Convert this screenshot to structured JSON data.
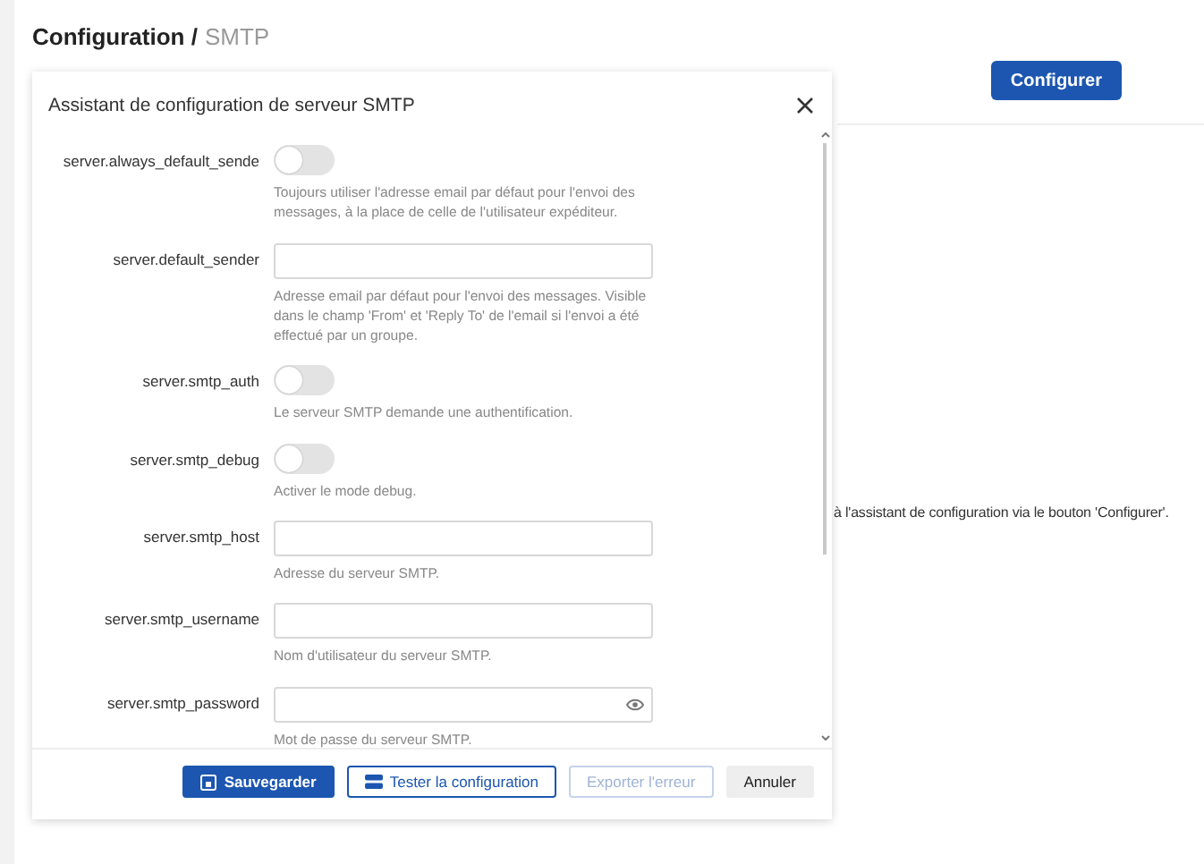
{
  "breadcrumb": {
    "section": "Configuration /",
    "page": "SMTP"
  },
  "configure_button": "Configurer",
  "background_text": "à l'assistant de configuration via le bouton 'Configurer'.",
  "dialog": {
    "title": "Assistant de configuration de serveur SMTP",
    "fields": [
      {
        "kind": "toggle",
        "label": "server.always_default_sende",
        "on": false,
        "help": "Toujours utiliser l'adresse email par défaut pour l'envoi des messages, à la place de celle de l'utilisateur expéditeur."
      },
      {
        "kind": "text",
        "label": "server.default_sender",
        "help": "Adresse email par défaut pour l'envoi des messages. Visible dans le champ 'From' et 'Reply To' de l'email si l'envoi a été effectué par un groupe."
      },
      {
        "kind": "toggle",
        "label": "server.smtp_auth",
        "on": false,
        "help": "Le serveur SMTP demande une authentification."
      },
      {
        "kind": "toggle",
        "label": "server.smtp_debug",
        "on": false,
        "help": "Activer le mode debug."
      },
      {
        "kind": "text",
        "label": "server.smtp_host",
        "help": "Adresse du serveur SMTP."
      },
      {
        "kind": "text",
        "label": "server.smtp_username",
        "help": "Nom d'utilisateur du serveur SMTP."
      },
      {
        "kind": "password",
        "label": "server.smtp_password",
        "help": "Mot de passe du serveur SMTP."
      }
    ],
    "buttons": [
      {
        "kind": "primary",
        "label": "Sauvegarder",
        "disabled": false
      },
      {
        "kind": "outline",
        "label": "Tester la configuration",
        "disabled": false
      },
      {
        "kind": "outline",
        "label": "Exporter l'erreur",
        "disabled": true
      },
      {
        "kind": "secondary",
        "label": "Annuler",
        "disabled": false
      }
    ]
  }
}
